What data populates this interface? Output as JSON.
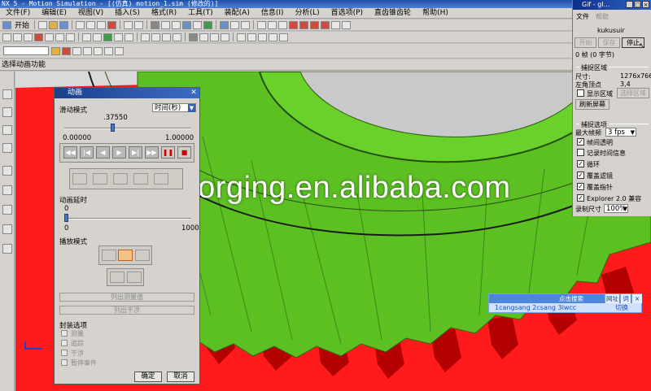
{
  "app": {
    "title": "NX 5 - Motion Simulation - [(仿真) motion_1.sim (修改的)]",
    "menu": [
      "文件(F)",
      "编辑(E)",
      "视图(V)",
      "插入(S)",
      "格式(R)",
      "工具(T)",
      "装配(A)",
      "信息(I)",
      "分析(L)",
      "首选项(P)",
      "直齿锥齿轮",
      "帮助(H)"
    ],
    "toolbar_start": "开始",
    "status_hint": "选择动画功能"
  },
  "watermark": "goldenforging.en.alibaba.com",
  "animation_dialog": {
    "title": "动画",
    "slide_mode_label": "滑动模式",
    "slide_mode_value": "时间(秒)",
    "slider_value": ".37550",
    "slider_position": 0.3755,
    "slider_min": "0.00000",
    "slider_max": "1.00000",
    "delay_label": "动画延时",
    "delay_value": "0",
    "delay_min": "0",
    "delay_max": "1000",
    "playback_label": "播放模式",
    "list_measure_button": "列出测量值",
    "list_interference_button": "列出干涉",
    "pause_options_label": "封装选项",
    "pause_options": [
      "测量",
      "追踪",
      "干涉",
      "暂停事件"
    ],
    "ok_button": "确定",
    "cancel_button": "取消"
  },
  "gif_panel": {
    "title": "Gif - gI...",
    "menu": [
      "文件",
      "帮助"
    ],
    "user": "kukusuir",
    "buttons": {
      "start": "开始",
      "save": "保存",
      "stop": "停止"
    },
    "frame_info": "0 帧 (0 字节)",
    "capture_area_title": "捕捉区域",
    "size_label": "尺寸:",
    "size_value": "1276x766",
    "top_left_label": "左角顶点",
    "top_left_value": "3,4",
    "show_area_label": "显示区域",
    "select_area_button": "选择区域",
    "refresh_button": "刷新屏幕",
    "capture_options_title": "捕捉选项",
    "max_fps_label": "最大帧频",
    "max_fps_value": "3 fps",
    "options": [
      {
        "label": "帧间透明",
        "checked": true
      },
      {
        "label": "记录时间信息",
        "checked": false
      },
      {
        "label": "循环",
        "checked": true
      },
      {
        "label": "覆盖滤镜",
        "checked": true
      },
      {
        "label": "覆盖指针",
        "checked": true
      },
      {
        "label": "Explorer 2.0 兼容",
        "checked": true
      }
    ],
    "record_size_label": "录制尺寸",
    "record_size_value": "100%"
  },
  "search_widget": {
    "title": "点击搜索",
    "tabs": [
      "网址",
      "词",
      "×"
    ],
    "query": "1cangsang 2csang 3iwcc",
    "switch_label": "切换"
  },
  "colors": {
    "gear_red": "#ff1a1a",
    "gear_green": "#5cbf22",
    "dialog_title": "#1b3f8c",
    "gif_title": "#0b2f8a"
  }
}
